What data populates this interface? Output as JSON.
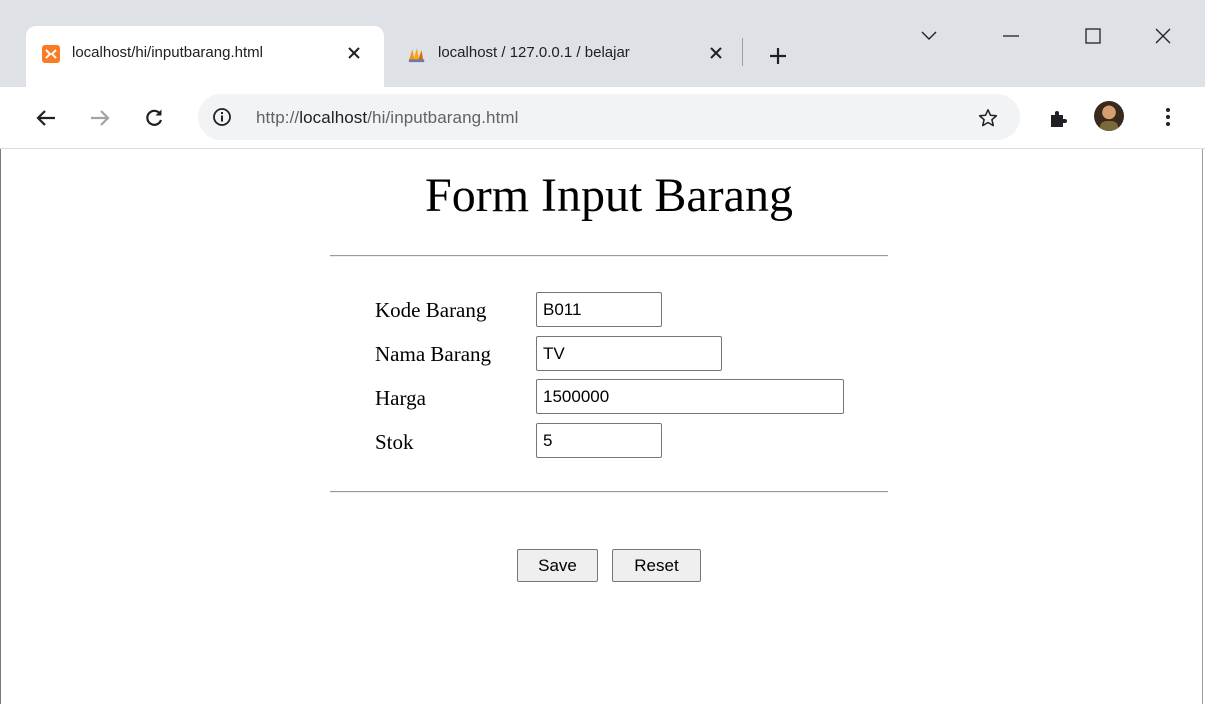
{
  "browser": {
    "tabs": [
      {
        "title": "localhost/hi/inputbarang.html",
        "active": true,
        "favicon": "xampp-icon"
      },
      {
        "title": "localhost / 127.0.0.1 / belajar",
        "active": false,
        "favicon": "phpmyadmin-icon"
      }
    ],
    "url": {
      "scheme": "http://",
      "host": "localhost",
      "path": "/hi/inputbarang.html"
    }
  },
  "page": {
    "title": "Form Input Barang",
    "fields": [
      {
        "label": "Kode Barang",
        "value": "B011"
      },
      {
        "label": "Nama Barang",
        "value": "TV"
      },
      {
        "label": "Harga",
        "value": "1500000"
      },
      {
        "label": "Stok",
        "value": "5"
      }
    ],
    "buttons": {
      "save": "Save",
      "reset": "Reset"
    }
  },
  "colors": {
    "tabstrip": "#dee1e6",
    "omnibox": "#f1f3f4",
    "xampp_orange": "#fb7a24"
  }
}
